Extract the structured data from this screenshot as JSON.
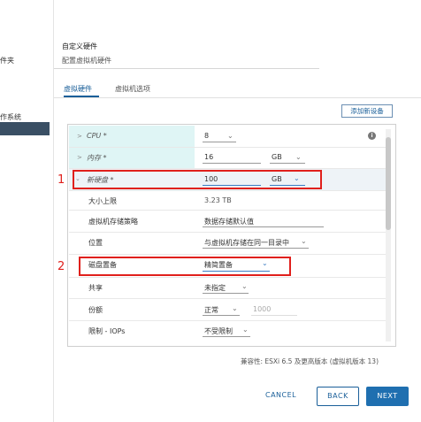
{
  "sidebar": {
    "item1": "件夹",
    "item2": "作系统"
  },
  "header": {
    "title": "自定义硬件",
    "subtitle": "配置虚拟机硬件"
  },
  "tabs": {
    "virtual_hardware": "虚拟硬件",
    "vm_options": "虚拟机选项"
  },
  "add_device_label": "添加新设备",
  "hardware": {
    "cpu": {
      "label": "CPU *",
      "value": "8"
    },
    "memory": {
      "label": "内存 *",
      "value": "16",
      "unit": "GB"
    },
    "new_disk": {
      "label": "新硬盘 *",
      "value": "100",
      "unit": "GB",
      "max_size_label": "大小上限",
      "max_size_value": "3.23 TB",
      "vm_storage_policy_label": "虚拟机存储策略",
      "vm_storage_policy_value": "数据存储默认值",
      "location_label": "位置",
      "location_value": "与虚拟机存储在同一目录中",
      "disk_provisioning_label": "磁盘置备",
      "disk_provisioning_value": "精简置备",
      "sharing_label": "共享",
      "sharing_value": "未指定",
      "shares_label": "份额",
      "shares_value": "正常",
      "shares_number": "1000",
      "limit_iops_label": "限制 - IOPs",
      "limit_iops_value": "不受限制"
    }
  },
  "annotations": {
    "marker1": "1",
    "marker2": "2"
  },
  "compatibility": "兼容性: ESXi 6.5 及更高版本 (虚拟机版本 13)",
  "buttons": {
    "cancel": "CANCEL",
    "back": "BACK",
    "next": "NEXT"
  },
  "colors": {
    "accent": "#1a5f99",
    "highlight": "#dff5f5",
    "annotation_red": "#e0201c",
    "sidebar_selected": "#3a4f64"
  }
}
